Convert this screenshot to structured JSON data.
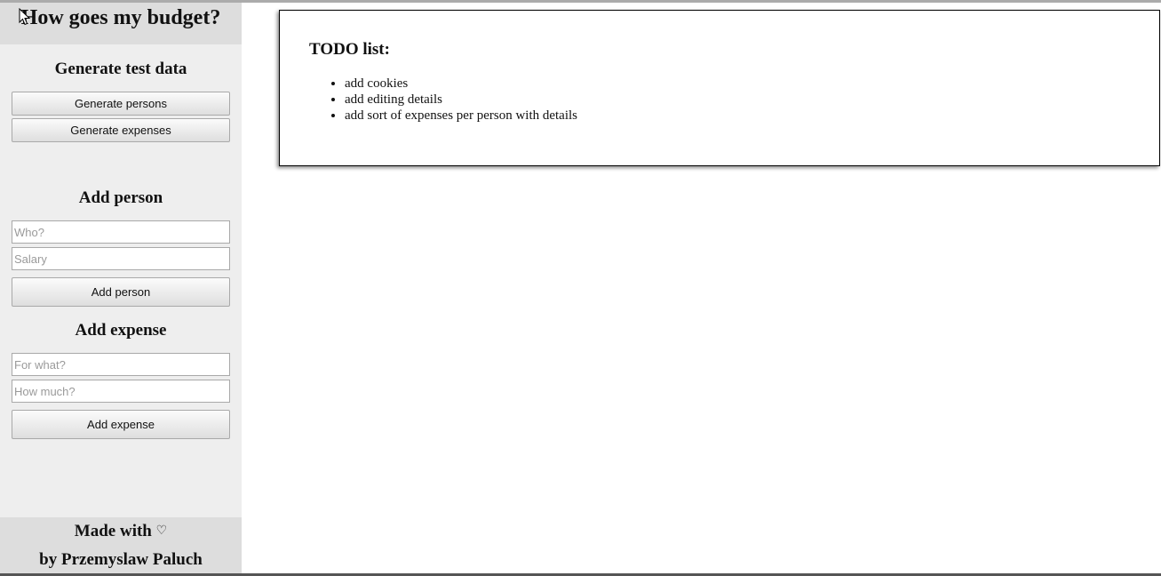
{
  "app": {
    "title": "How goes my budget?"
  },
  "sidebar": {
    "generate": {
      "heading": "Generate test data",
      "persons_button": "Generate persons",
      "expenses_button": "Generate expenses"
    },
    "add_person": {
      "heading": "Add person",
      "who_placeholder": "Who?",
      "salary_placeholder": "Salary",
      "button": "Add person"
    },
    "add_expense": {
      "heading": "Add expense",
      "for_what_placeholder": "For what?",
      "how_much_placeholder": "How much?",
      "button": "Add expense"
    },
    "footer": {
      "made_with": "Made with",
      "heart": "♡",
      "by": "by Przemyslaw Paluch"
    }
  },
  "main": {
    "todo": {
      "title": "TODO list:",
      "items": [
        "add cookies",
        "add editing details",
        "add sort of expenses per person with details"
      ]
    }
  }
}
